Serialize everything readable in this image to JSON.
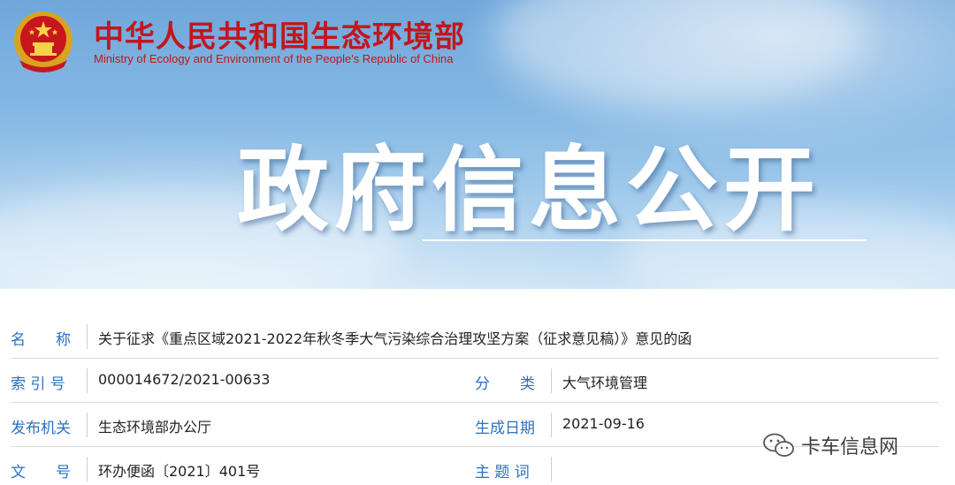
{
  "header": {
    "ministry_name_cn": "中华人民共和国生态环境部",
    "ministry_name_en": "Ministry of Ecology and Environment of the People's Republic of China",
    "banner_title": "政府信息公开",
    "emblem_icon": "national-emblem-icon"
  },
  "colors": {
    "ministry_red": "#c0171d",
    "label_blue": "#2a72c3",
    "banner_sky": "#86b9e4"
  },
  "info": {
    "name_label": "名　　称",
    "name_value": "关于征求《重点区域2021-2022年秋冬季大气污染综合治理攻坚方案（征求意见稿）》意见的函",
    "index_label": "索 引 号",
    "index_value": "000014672/2021-00633",
    "category_label": "分　　类",
    "category_value": "大气环境管理",
    "issuer_label": "发布机关",
    "issuer_value": "生态环境部办公厅",
    "date_label": "生成日期",
    "date_value": "2021-09-16",
    "docno_label": "文　　号",
    "docno_value": "环办便函〔2021〕401号",
    "keywords_label": "主 题 词",
    "keywords_value": ""
  },
  "watermark": {
    "text": "卡车信息网",
    "icon": "wechat-icon"
  }
}
